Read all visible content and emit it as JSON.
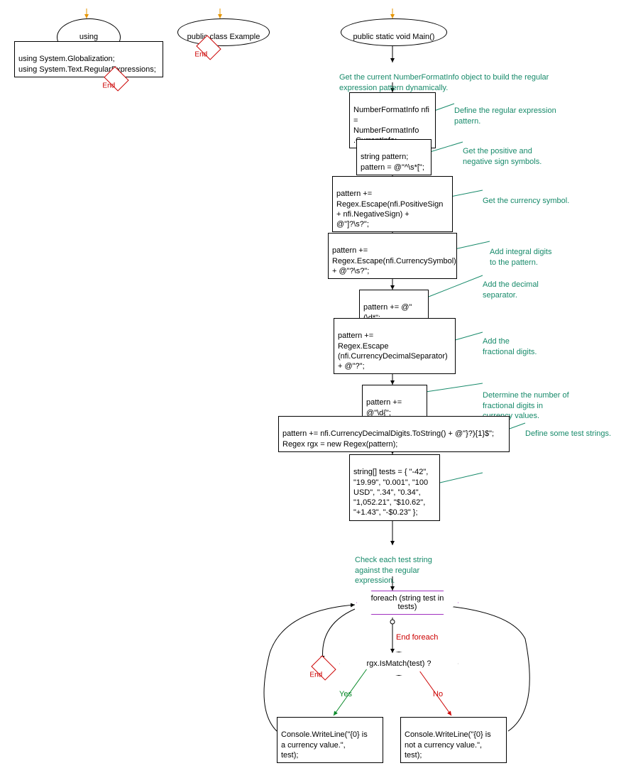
{
  "nodes": {
    "usingSystem": "using System;",
    "usingDecl": "using System.Globalization;\nusing System.Text.RegularExpressions;",
    "endLabel": "End",
    "classDecl": "public class Example",
    "mainDecl": "public static void Main()",
    "n1": "NumberFormatInfo nfi =\nNumberFormatInfo\n.CurrentInfo;",
    "n2": "string pattern;\npattern = @\"^\\s*[\";",
    "n3": "pattern +=\nRegex.Escape(nfi.PositiveSign\n+ nfi.NegativeSign) +\n@\"]?\\s?\";",
    "n4": "pattern +=\nRegex.Escape(nfi.CurrencySymbol)\n+ @\"?\\s?\";",
    "n5": "pattern += @\"(\\d*\";",
    "n6": "pattern +=\nRegex.Escape\n(nfi.CurrencyDecimalSeparator)\n+ @\"?\";",
    "n7": "pattern += @\"\\d{\";",
    "n8": "pattern += nfi.CurrencyDecimalDigits.ToString() + @\"}?){1}$\";\nRegex rgx = new Regex(pattern);",
    "n9": "string[] tests = { \"-42\",\n\"19.99\", \"0.001\", \"100\nUSD\", \".34\", \"0.34\",\n\"1,052.21\", \"$10.62\",\n\"+1.43\", \"-$0.23\" };",
    "loop": "foreach (string\ntest in tests)",
    "decision": "rgx.IsMatch(test) ?",
    "yesOut": "Console.WriteLine(\"{0} is\na currency value.\",\ntest);",
    "noOut": "Console.WriteLine(\"{0} is\nnot a currency value.\",\ntest);",
    "endForeach": "End foreach"
  },
  "comments": {
    "c1": "Get the current NumberFormatInfo object to build the regular\nexpression pattern dynamically.",
    "c2": "Define the regular expression\npattern.",
    "c3": "Get the positive and\nnegative sign symbols.",
    "c4": "Get the currency symbol.",
    "c5": "Add integral digits\nto the pattern.",
    "c6": "Add the decimal\nseparator.",
    "c7": "Add the\nfractional digits.",
    "c8": "Determine the number of\nfractional digits in\ncurrency values.",
    "c9": "Define some test strings.",
    "c10": "Check each test string\nagainst the regular\nexpression."
  },
  "labels": {
    "yes": "Yes",
    "no": "No"
  }
}
